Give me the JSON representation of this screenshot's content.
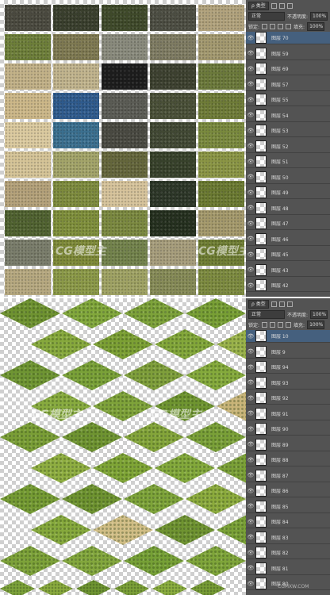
{
  "colors": {
    "panel_bg": "#535353",
    "row_border": "#414141",
    "selection": "#45607e",
    "grass_light": "#8fb040",
    "grass_dark": "#5f7e2a",
    "sand": "#cdb889",
    "water": "#3b6f93"
  },
  "top_tiles": [
    [
      "#4b4a3f",
      "#3a3f2d",
      "#3f4a2a",
      "#4d4e43",
      "#b2a37d"
    ],
    [
      "#6e7f3a",
      "#7f7a52",
      "#8a8b7d",
      "#7f7c63",
      "#a49a70"
    ],
    [
      "#c3b288",
      "#c2b58e",
      "#1d1d1d",
      "#3d4130",
      "#6c7a3b"
    ],
    [
      "#cdb889",
      "#2f5b8e",
      "#5b5c55",
      "#4a5038",
      "#6f7c38"
    ],
    [
      "#dccba0",
      "#3b7090",
      "#4a4a42",
      "#424934",
      "#7a8a3e"
    ],
    [
      "#d6c598",
      "#a4a56a",
      "#65673c",
      "#38422b",
      "#8b9645"
    ],
    [
      "#b5a27a",
      "#7e8c3e",
      "#d7c49c",
      "#2d3728",
      "#6b7a31"
    ],
    [
      "#506230",
      "#7f8f3b",
      "#7b8940",
      "#25301f",
      "#a59a6c"
    ],
    [
      "#7a7d6b",
      "#7e8a38",
      "#73834c",
      "#a79e7c",
      "#6f7e33"
    ],
    [
      "#b7a980",
      "#8c9a48",
      "#a0a364",
      "#868b57",
      "#7d8b40"
    ]
  ],
  "diamonds_rows": [
    [
      "#6f9331",
      "#82a83c",
      "#7da23a",
      "#789f35"
    ],
    [
      "#87a93d",
      "#7ca034",
      "#83a73a",
      "#9ab24a"
    ],
    [
      "#6f9533",
      "#7aa138",
      "#7f9f3b",
      "#85aa3c"
    ],
    [
      "#88ab3f",
      "#7fa33a",
      "#6f9530",
      "#c8b478"
    ],
    [
      "#7a9e36",
      "#6f9431",
      "#84a53a",
      "#7aa038"
    ],
    [
      "#8fae41",
      "#7fa536",
      "#83a93b",
      "#7ba037"
    ],
    [
      "#759b33",
      "#6e9330",
      "#7ea43a",
      "#8cab3d"
    ],
    [
      "#86a93c",
      "#d0bd85",
      "#6f9331",
      "#7aa137"
    ],
    [
      "#7da239",
      "#83a73d",
      "#76a036",
      "#7fa53a"
    ]
  ],
  "diamonds_small_rows": [
    [
      "#7da33a",
      "#8aab3e",
      "#6f9532",
      "#7ca138",
      "#8caf40",
      "#789d35"
    ],
    [
      "#8aad42",
      "#79a036",
      "#c7b47a",
      "#6f9330",
      "#83a63a",
      "#7ba038"
    ]
  ],
  "layers_top": {
    "kind_filter": "ρ 类型",
    "blend_mode": "正常",
    "opacity_label": "不透明度:",
    "opacity_value": "100%",
    "lock_label": "锁定:",
    "fill_label": "填充:",
    "fill_value": "100%",
    "layers": [
      "图层 70",
      "图层 59",
      "图层 69",
      "图层 57",
      "图层 55",
      "图层 54",
      "图层 53",
      "图层 52",
      "图层 51",
      "图层 50",
      "图层 49",
      "图层 48",
      "图层 47",
      "图层 46",
      "图层 45",
      "图层 43",
      "图层 42"
    ]
  },
  "layers_bottom": {
    "kind_filter": "ρ 类型",
    "blend_mode": "正常",
    "opacity_label": "不透明度:",
    "opacity_value": "100%",
    "lock_label": "锁定:",
    "fill_label": "填充:",
    "fill_value": "100%",
    "layers": [
      "图层 10",
      "图层 9",
      "图层 94",
      "图层 93",
      "图层 92",
      "图层 91",
      "图层 90",
      "图层 89",
      "图层 88",
      "图层 87",
      "图层 86",
      "图层 85",
      "图层 84",
      "图层 83",
      "图层 82",
      "图层 81",
      "图层 80"
    ]
  },
  "watermark": {
    "brand": "CG模型主",
    "url": "CGMXW.COM"
  }
}
